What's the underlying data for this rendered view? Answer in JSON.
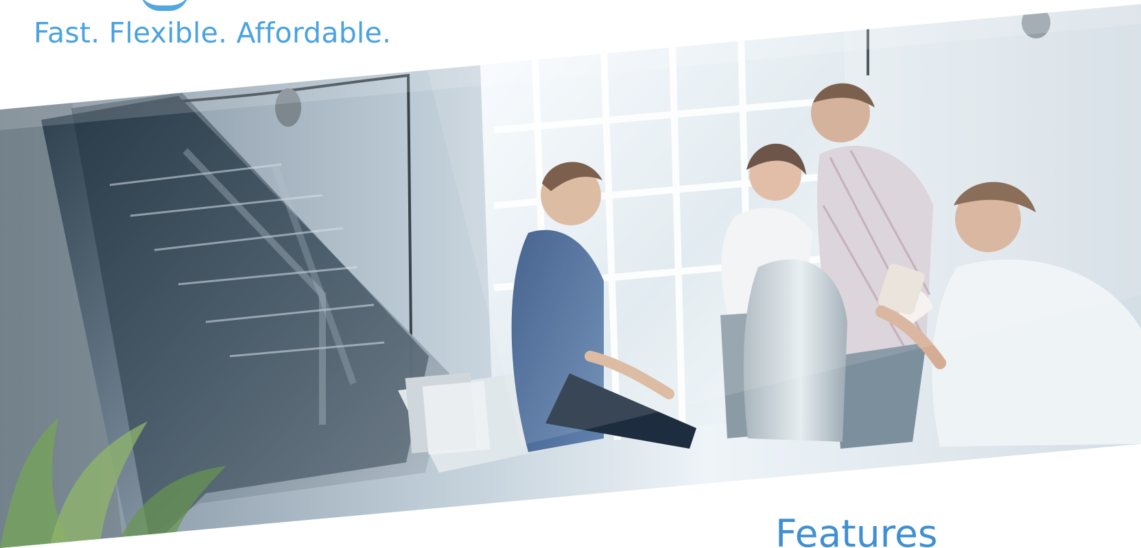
{
  "header": {
    "tagline": "Fast. Flexible. Affordable."
  },
  "hero": {
    "icon": "team-office-photo-icon"
  },
  "section": {
    "title": "Features"
  },
  "colors": {
    "accent": "#4aa3df",
    "heading": "#3f8fd1"
  }
}
